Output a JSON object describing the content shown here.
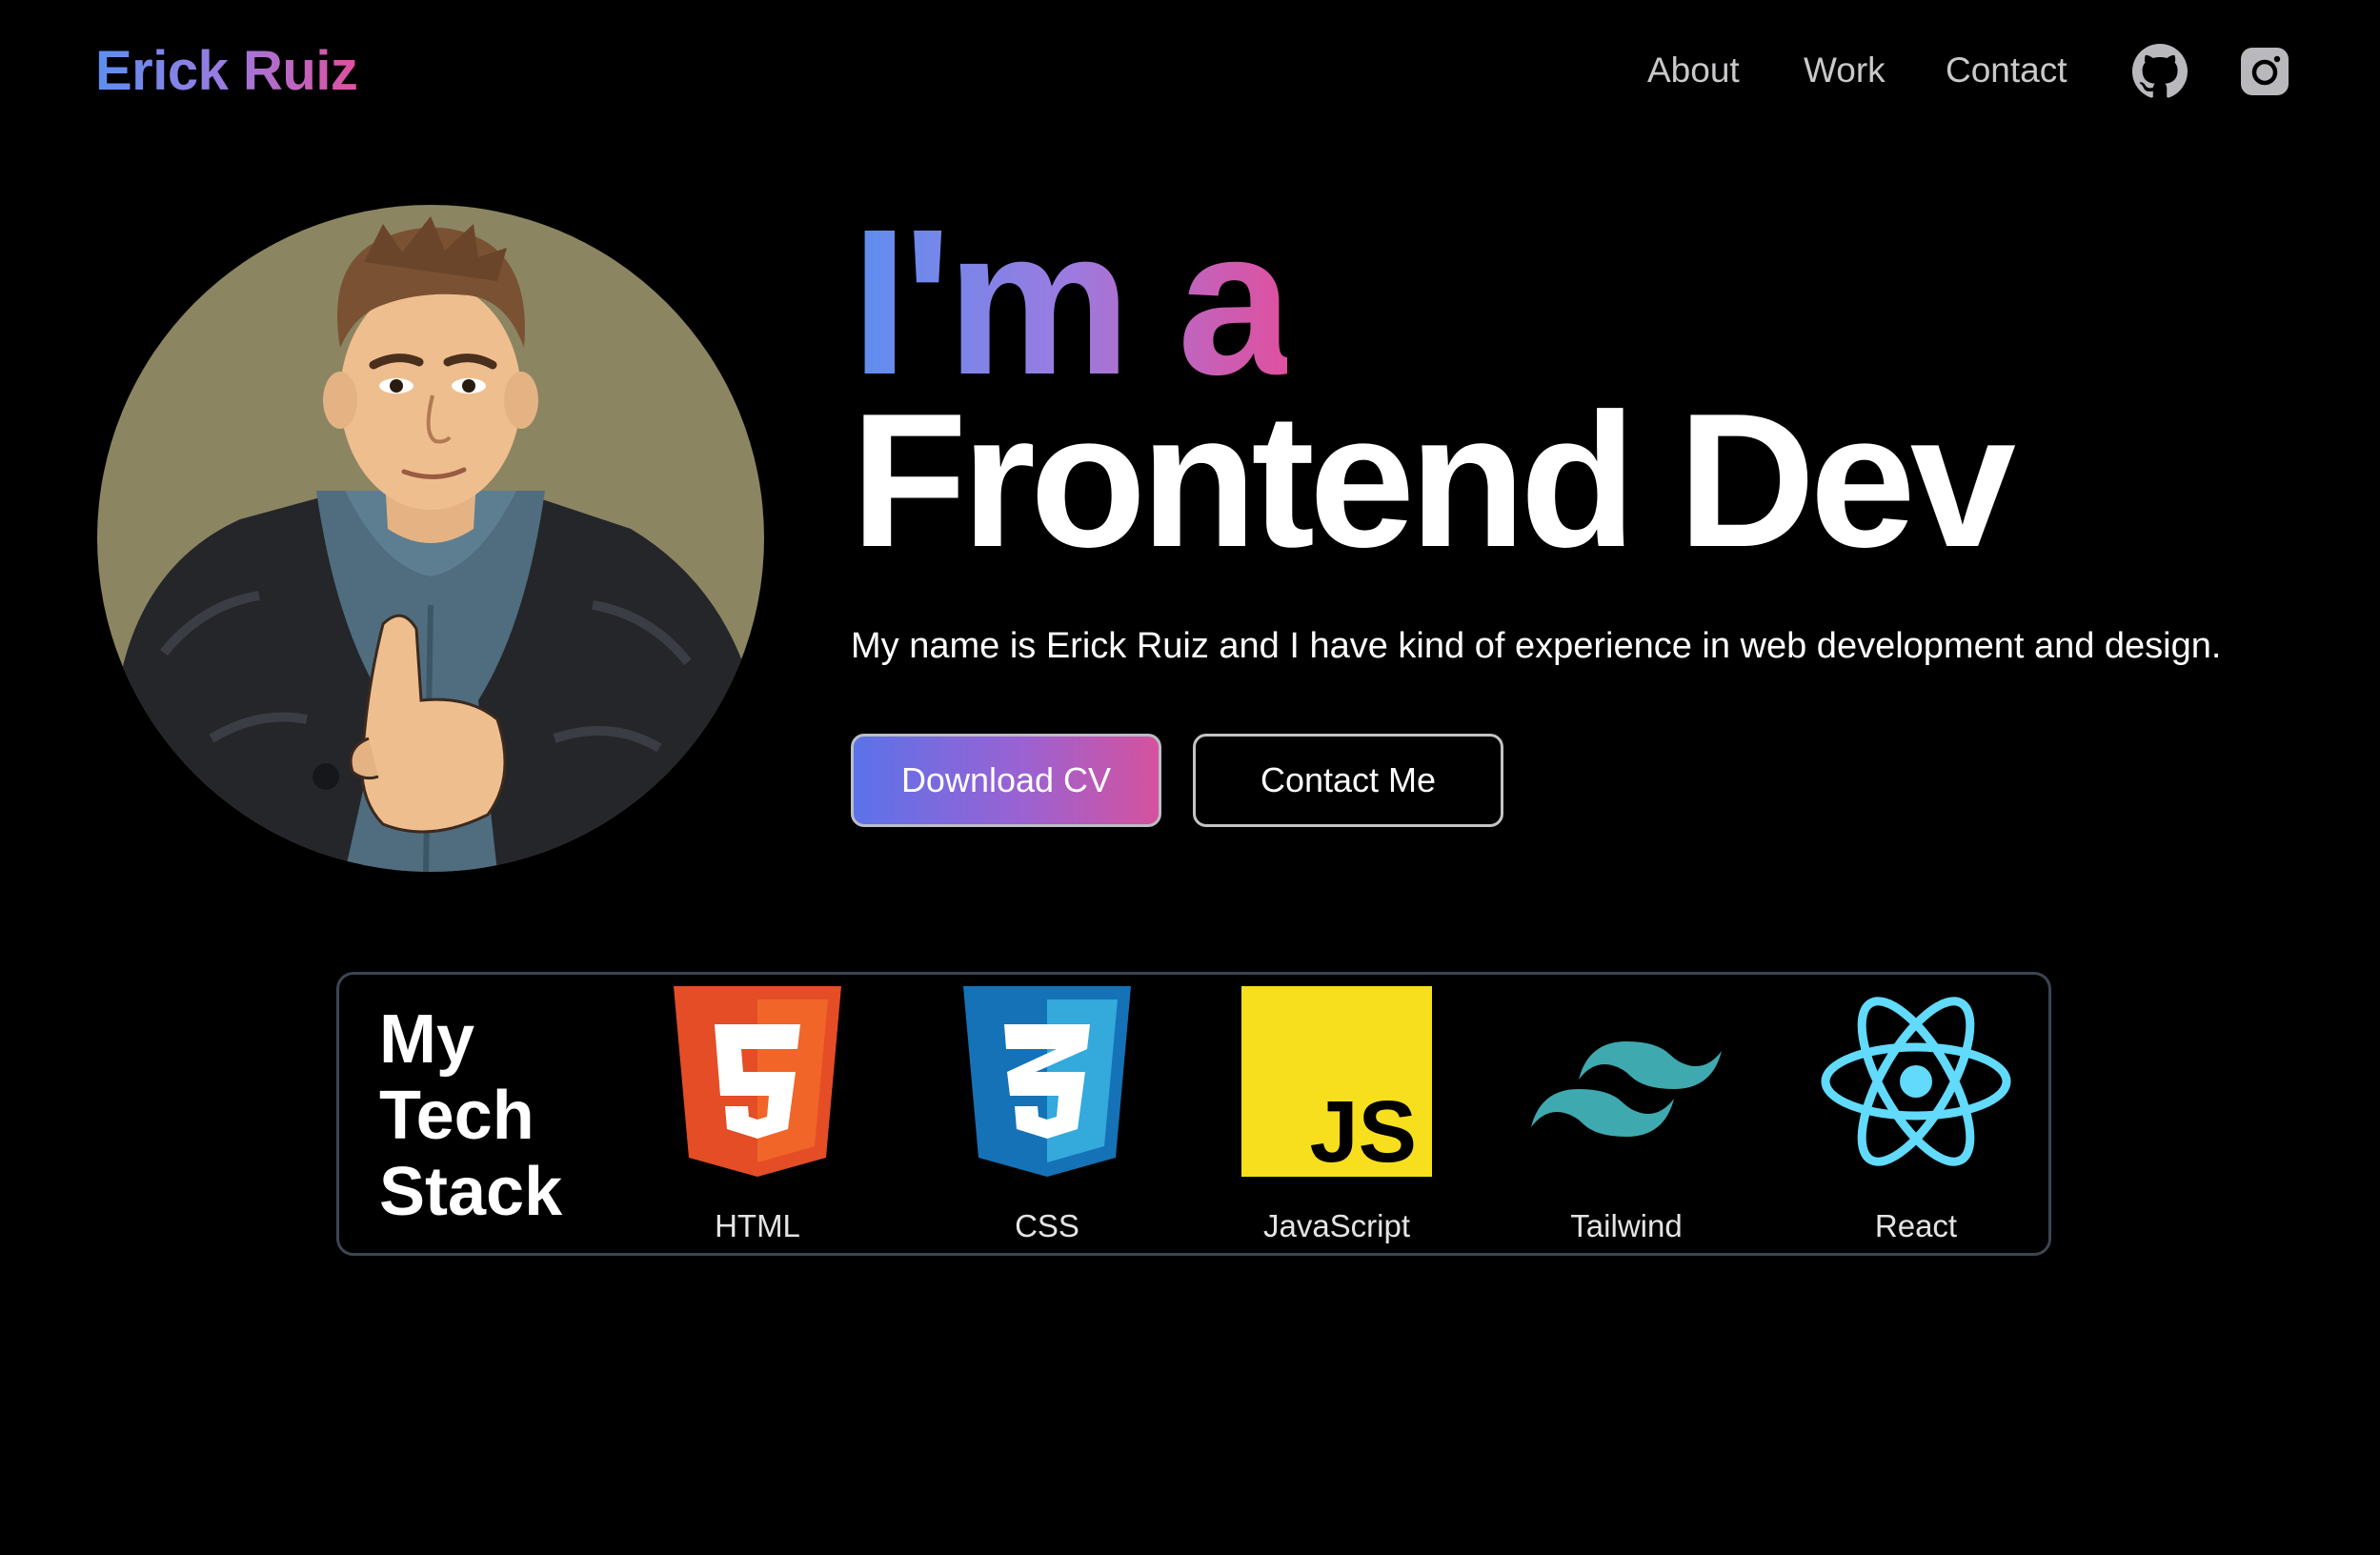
{
  "header": {
    "logo": "Erick Ruiz",
    "nav": [
      "About",
      "Work",
      "Contact"
    ],
    "icons": [
      "github-icon",
      "instagram-icon"
    ]
  },
  "hero": {
    "line1": "I'm a",
    "line2": "Frontend Dev",
    "description": "My name is Erick Ruiz and I have kind of experience in web development and design.",
    "primary_button": "Download CV",
    "secondary_button": "Contact Me"
  },
  "tech_stack": {
    "title": [
      "My",
      "Tech",
      "Stack"
    ],
    "items": [
      {
        "label": "HTML",
        "icon": "html5-icon"
      },
      {
        "label": "CSS",
        "icon": "css3-icon"
      },
      {
        "label": "JavaScript",
        "icon": "javascript-icon"
      },
      {
        "label": "Tailwind",
        "icon": "tailwind-icon"
      },
      {
        "label": "React",
        "icon": "react-icon"
      }
    ]
  },
  "colors": {
    "background": "#000000",
    "gradient_start": "#5c8ff0",
    "gradient_end": "#e0509f",
    "html_orange": "#e34f26",
    "css_blue": "#2965f1",
    "js_yellow": "#f7df1e",
    "tailwind_teal": "#38b2ac",
    "react_cyan": "#61dafb"
  }
}
